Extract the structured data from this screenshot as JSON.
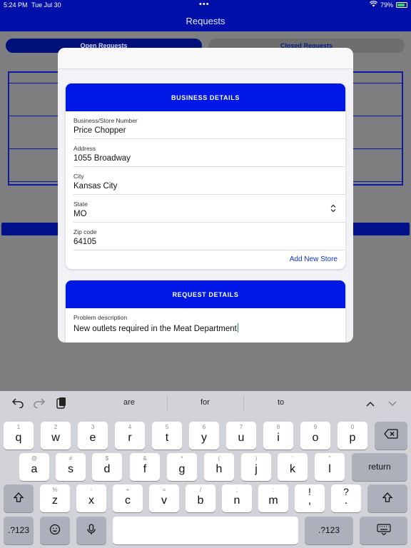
{
  "status": {
    "time": "5:24 PM",
    "date": "Tue Jul 30",
    "battery": "79%"
  },
  "nav": {
    "title": "Requests"
  },
  "tabs": {
    "open": "Open Requests",
    "closed": "Closed Requests"
  },
  "business": {
    "header": "BUSINESS DETAILS",
    "fields": [
      {
        "label": "Business/Store Number",
        "value": "Price Chopper"
      },
      {
        "label": "Address",
        "value": "1055 Broadway"
      },
      {
        "label": "City",
        "value": "Kansas City"
      },
      {
        "label": "State",
        "value": "MO"
      },
      {
        "label": "Zip code",
        "value": "64105"
      }
    ],
    "add_store": "Add New Store"
  },
  "request": {
    "header": "REQUEST DETAILS",
    "problem_label": "Problem description",
    "problem_value": "New outlets required in the Meat Department"
  },
  "keyboard": {
    "suggestions": [
      "are",
      "for",
      "to"
    ],
    "row1": [
      [
        "1",
        "q"
      ],
      [
        "2",
        "w"
      ],
      [
        "3",
        "e"
      ],
      [
        "4",
        "r"
      ],
      [
        "5",
        "t"
      ],
      [
        "6",
        "y"
      ],
      [
        "7",
        "u"
      ],
      [
        "8",
        "i"
      ],
      [
        "9",
        "o"
      ],
      [
        "0",
        "p"
      ]
    ],
    "row2": [
      [
        "@",
        "a"
      ],
      [
        "#",
        "s"
      ],
      [
        "$",
        "d"
      ],
      [
        "&",
        "f"
      ],
      [
        "*",
        "g"
      ],
      [
        "(",
        "h"
      ],
      [
        ")",
        "j"
      ],
      [
        "'",
        "k"
      ],
      [
        "\"",
        "l"
      ]
    ],
    "row3": [
      [
        "%",
        "z"
      ],
      [
        "-",
        "x"
      ],
      [
        "+",
        "c"
      ],
      [
        "=",
        "v"
      ],
      [
        "/",
        "b"
      ],
      [
        ";",
        "n"
      ],
      [
        ":",
        "m"
      ],
      [
        "!",
        ","
      ],
      [
        "?",
        "."
      ]
    ],
    "return_label": "return",
    "numbers_label": ".?123"
  },
  "icons": {
    "undo": "undo-icon",
    "redo": "redo-icon",
    "paste": "paste-icon",
    "chevron_up": "chevron-up-icon",
    "chevron_down": "chevron-down-icon",
    "backspace": "backspace-icon",
    "shift": "shift-icon",
    "emoji": "emoji-icon",
    "mic": "microphone-icon",
    "hide_keyboard": "keyboard-hide-icon"
  },
  "colors": {
    "nav": "#0010a8",
    "card_header": "#0018e6",
    "link": "#0a2fd0",
    "keyboard": "#d1d3d9"
  }
}
